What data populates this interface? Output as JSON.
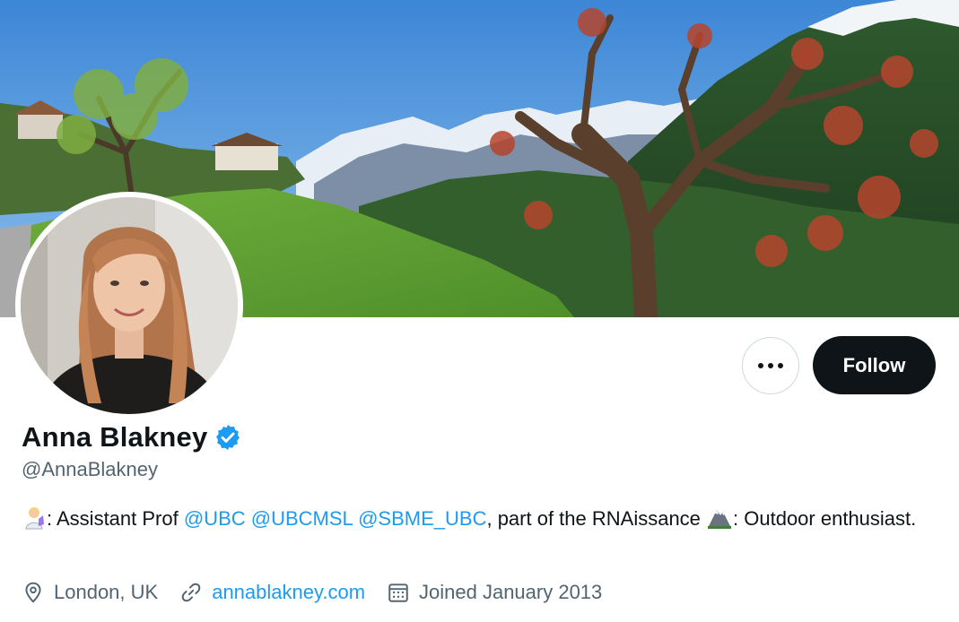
{
  "profile": {
    "name": "Anna Blakney",
    "handle": "@AnnaBlakney",
    "verified": true
  },
  "actions": {
    "follow_label": "Follow",
    "more_icon": "more-horizontal-icon"
  },
  "bio": {
    "emoji1": "scientist-emoji",
    "text1": ": Assistant Prof ",
    "mention1": "@UBC",
    "mention2": "@UBCMSL",
    "mention3": "@SBME_UBC",
    "text2": ", part of the RNAissance ",
    "emoji2": "mountain-emoji",
    "text3": ": Outdoor enthusiast."
  },
  "meta": {
    "location": "London, UK",
    "website": "annablakney.com",
    "joined": "Joined January 2013"
  },
  "colors": {
    "accent": "#1d9bf0",
    "text": "#0f1419",
    "secondary": "#536471",
    "follow_bg": "#0f1419"
  }
}
